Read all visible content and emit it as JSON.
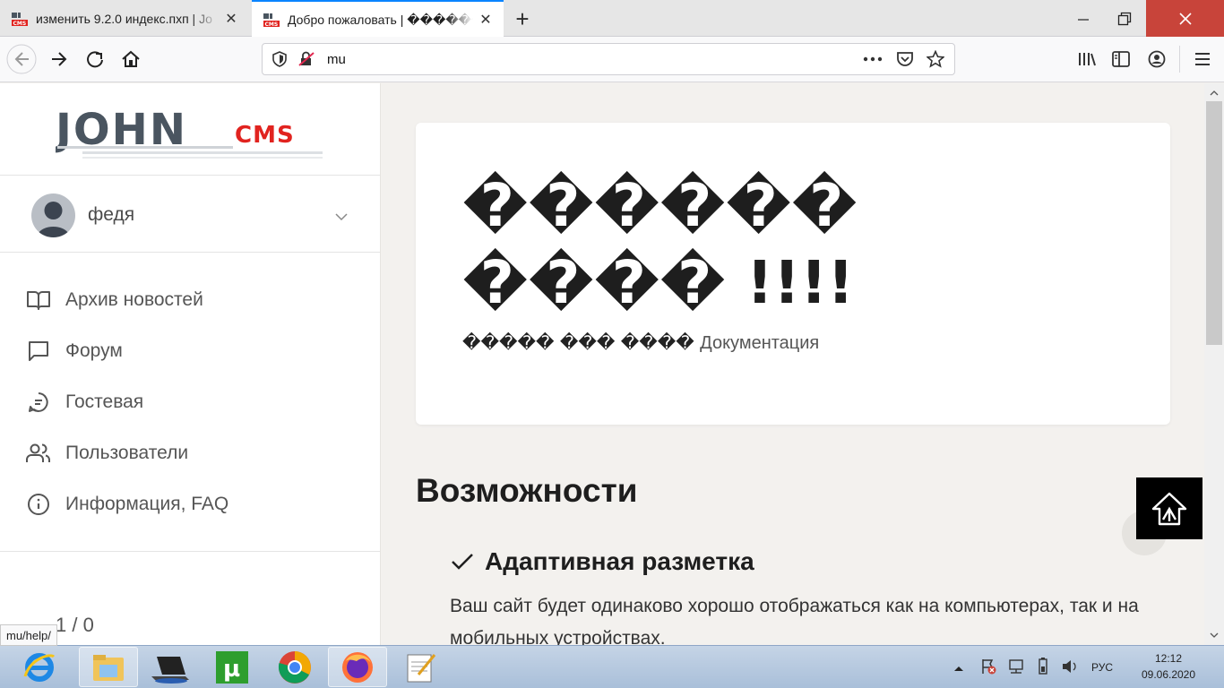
{
  "browser": {
    "tabs": [
      {
        "title": "изменить 9.2.0 индекс.пхп | Jo",
        "active": false
      },
      {
        "title": "Добро пожаловать | ������",
        "active": true
      }
    ],
    "url": "mu",
    "status_url": "mu/help/"
  },
  "sidebar": {
    "logo_main": "JOHN",
    "logo_cms": "CMS",
    "username": "федя",
    "menu": [
      {
        "label": "Архив новостей",
        "icon": "book-icon"
      },
      {
        "label": "Форум",
        "icon": "chat-icon"
      },
      {
        "label": "Гостевая",
        "icon": "guestbook-icon"
      },
      {
        "label": "Пользователи",
        "icon": "users-icon"
      },
      {
        "label": "Информация, FAQ",
        "icon": "info-icon"
      }
    ],
    "counter": "1 / 0"
  },
  "main": {
    "hero_title_line1": "������",
    "hero_title_line2": "���� !!!!",
    "hero_sub_garbled": "����� ��� ���� ",
    "hero_doc_link": "Документация",
    "features_title": "Возможности",
    "feature_heading": "Адаптивная разметка",
    "feature_text": "Ваш сайт будет одинаково хорошо отображаться как на компьютерах, так и на мобильных устройствах."
  },
  "taskbar": {
    "lang": "РУС",
    "time": "12:12",
    "date": "09.06.2020"
  },
  "colors": {
    "accent_tab": "#0a84ff",
    "logo_red": "#e1231f",
    "logo_gray": "#4a5560",
    "close_red": "#c8443a"
  }
}
